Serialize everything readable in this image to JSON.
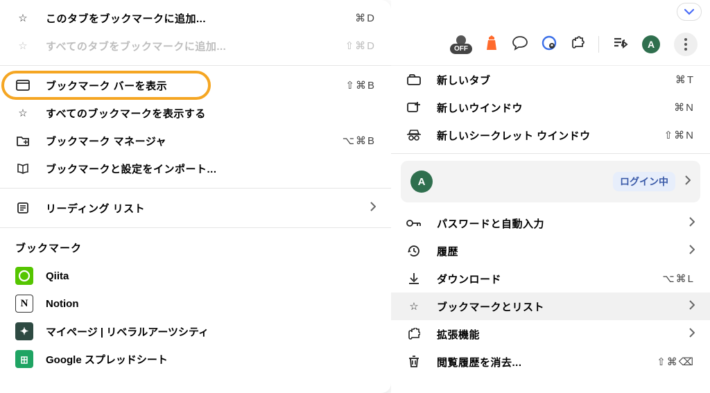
{
  "left_submenu": {
    "section1": [
      {
        "icon": "star-outline-icon",
        "label": "このタブをブックマークに追加...",
        "shortcut": "⌘D",
        "disabled": false
      },
      {
        "icon": "star-outline-icon",
        "label": "すべてのタブをブックマークに追加...",
        "shortcut": "⇧⌘D",
        "disabled": true
      }
    ],
    "section2": [
      {
        "icon": "panel-icon",
        "label": "ブックマーク バーを表示",
        "shortcut": "⇧⌘B",
        "highlight": true
      },
      {
        "icon": "star-outline-icon",
        "label": "すべてのブックマークを表示する",
        "shortcut": ""
      },
      {
        "icon": "folder-plus-icon",
        "label": "ブックマーク マネージャ",
        "shortcut": "⌥⌘B"
      },
      {
        "icon": "book-icon",
        "label": "ブックマークと設定をインポート...",
        "shortcut": ""
      }
    ],
    "reading_list": {
      "icon": "notes-icon",
      "label": "リーディング リスト",
      "submenu": true
    },
    "bookmarks_heading": "ブックマーク",
    "bookmarks": [
      {
        "icon_bg": "#55c500",
        "icon_fg": "#ffffff",
        "glyph": "◎",
        "label": "Qiita"
      },
      {
        "icon_bg": "#ffffff",
        "icon_fg": "#000000",
        "glyph": "N",
        "border": true,
        "label": "Notion"
      },
      {
        "icon_bg": "#2e4a42",
        "icon_fg": "#ffffff",
        "glyph": "✳",
        "label": "マイページ | リベラルアーツシティ"
      },
      {
        "icon_bg": "#1fa463",
        "icon_fg": "#ffffff",
        "glyph": "▦",
        "label": "Google スプレッドシート"
      }
    ]
  },
  "toolbar": {
    "ext_off_label": "OFF",
    "avatar_initial": "A"
  },
  "profile": {
    "avatar_initial": "A",
    "status_label": "ログイン中"
  },
  "main_menu": {
    "section1": [
      {
        "icon": "tab-icon",
        "label": "新しいタブ",
        "shortcut": "⌘T"
      },
      {
        "icon": "window-new-icon",
        "label": "新しいウインドウ",
        "shortcut": "⌘N"
      },
      {
        "icon": "incognito-icon",
        "label": "新しいシークレット ウインドウ",
        "shortcut": "⇧⌘N"
      }
    ],
    "section2": [
      {
        "icon": "key-icon",
        "label": "パスワードと自動入力",
        "submenu": true
      },
      {
        "icon": "history-icon",
        "label": "履歴",
        "submenu": true
      },
      {
        "icon": "download-icon",
        "label": "ダウンロード",
        "shortcut": "⌥⌘L"
      },
      {
        "icon": "star-outline-icon",
        "label": "ブックマークとリスト",
        "submenu": true,
        "hover": true
      },
      {
        "icon": "puzzle-icon",
        "label": "拡張機能",
        "submenu": true
      },
      {
        "icon": "trash-icon",
        "label": "閲覧履歴を消去...",
        "shortcut": "⇧⌘⌫"
      }
    ]
  }
}
